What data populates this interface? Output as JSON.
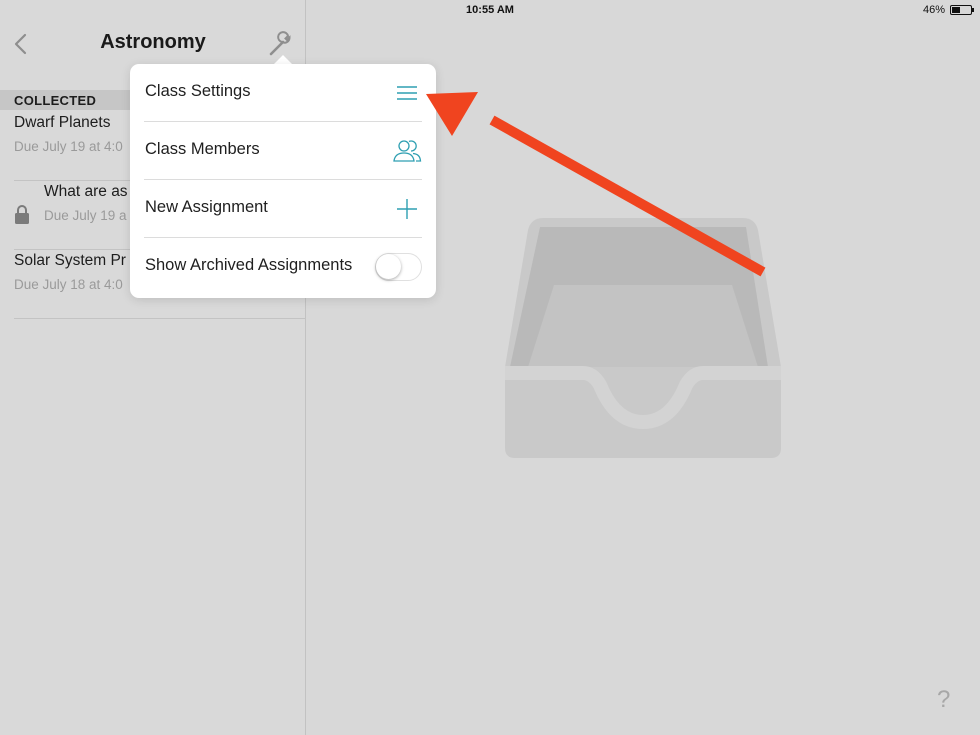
{
  "status_bar": {
    "device": "iPad",
    "time": "10:55 AM",
    "battery": "46%",
    "battery_level": 0.46
  },
  "nav": {
    "title": "Astronomy"
  },
  "section": {
    "label": "COLLECTED"
  },
  "assignments": [
    {
      "title": "Dwarf Planets",
      "due": "Due July 19 at 4:0",
      "locked": false
    },
    {
      "title": "What are as",
      "due": "Due July 19 a",
      "locked": true
    },
    {
      "title": "Solar System Pr",
      "due": "Due July 18 at 4:0",
      "locked": false
    }
  ],
  "popover": {
    "items": [
      {
        "label": "Class Settings",
        "icon": "menu-lines-icon"
      },
      {
        "label": "Class Members",
        "icon": "people-icon"
      },
      {
        "label": "New Assignment",
        "icon": "plus-icon"
      },
      {
        "label": "Show Archived Assignments",
        "control": "toggle",
        "value": false
      }
    ]
  },
  "help": {
    "label": "?"
  },
  "colors": {
    "accent": "#2e9fb2",
    "annotation": "#f0441f",
    "tray": "#c9c9c9"
  }
}
